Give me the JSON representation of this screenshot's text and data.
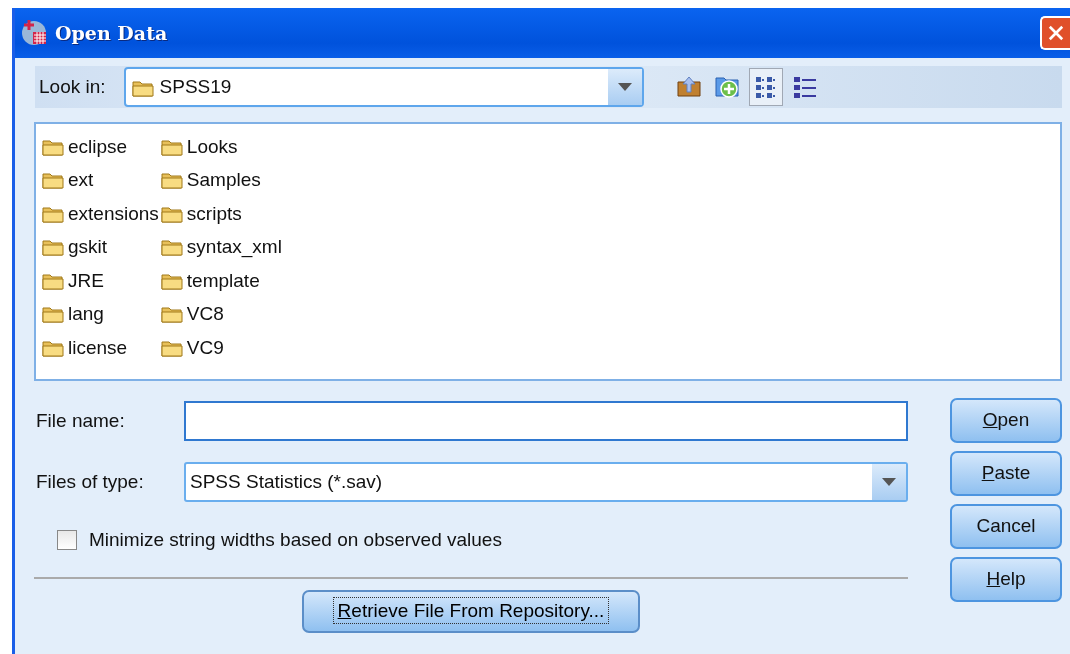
{
  "window": {
    "title": "Open Data"
  },
  "look_in": {
    "label": "Look in:",
    "value": "SPSS19"
  },
  "toolbar": [
    {
      "kind": "up",
      "selected": false
    },
    {
      "kind": "newfolder",
      "selected": false
    },
    {
      "kind": "list",
      "selected": true
    },
    {
      "kind": "details",
      "selected": false
    }
  ],
  "files": [
    {
      "name": "eclipse"
    },
    {
      "name": "ext"
    },
    {
      "name": "extensions"
    },
    {
      "name": "gskit"
    },
    {
      "name": "JRE"
    },
    {
      "name": "lang"
    },
    {
      "name": "license"
    },
    {
      "name": "Looks"
    },
    {
      "name": "Samples"
    },
    {
      "name": "scripts"
    },
    {
      "name": "syntax_xml"
    },
    {
      "name": "template"
    },
    {
      "name": "VC8"
    },
    {
      "name": "VC9"
    }
  ],
  "file_name": {
    "label": "File name:"
  },
  "files_of_type": {
    "label": "Files of type:",
    "value": "SPSS Statistics (*.sav)"
  },
  "minimize_option": {
    "label": "Minimize string widths based on observed values",
    "checked": false
  },
  "retrieve_button": {
    "label": "Retrieve File From Repository...",
    "underline_first": true
  },
  "buttons": [
    {
      "label": "Open",
      "underline_first": true
    },
    {
      "label": "Paste",
      "underline_first": true
    },
    {
      "label": "Cancel",
      "underline_first": false
    },
    {
      "label": "Help",
      "underline_first": true
    }
  ]
}
